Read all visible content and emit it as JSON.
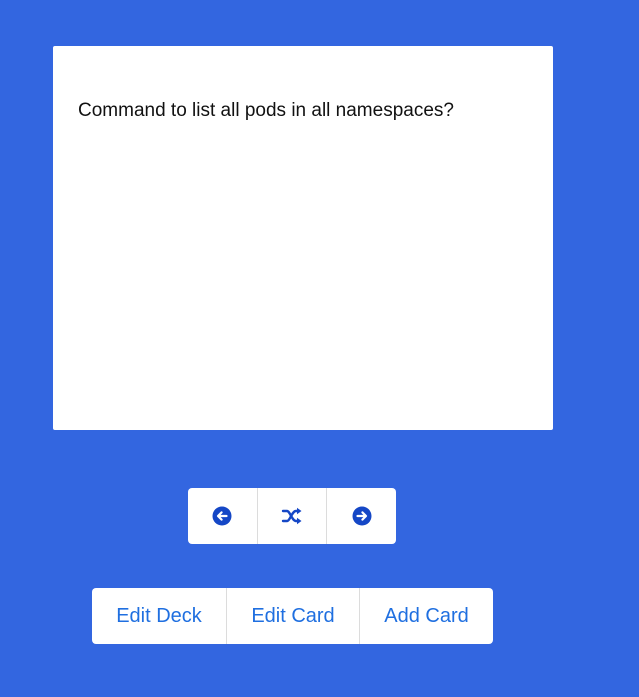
{
  "card": {
    "question": "Command to list all pods in all namespaces?"
  },
  "navigation": {
    "icons": [
      "arrow-left-circle-icon",
      "shuffle-icon",
      "arrow-right-circle-icon"
    ],
    "icon_color": "#1547c6"
  },
  "actions": {
    "edit_deck_label": "Edit Deck",
    "edit_card_label": "Edit Card",
    "add_card_label": "Add Card"
  },
  "colors": {
    "background": "#3366e0",
    "link": "#1f6fe0"
  }
}
